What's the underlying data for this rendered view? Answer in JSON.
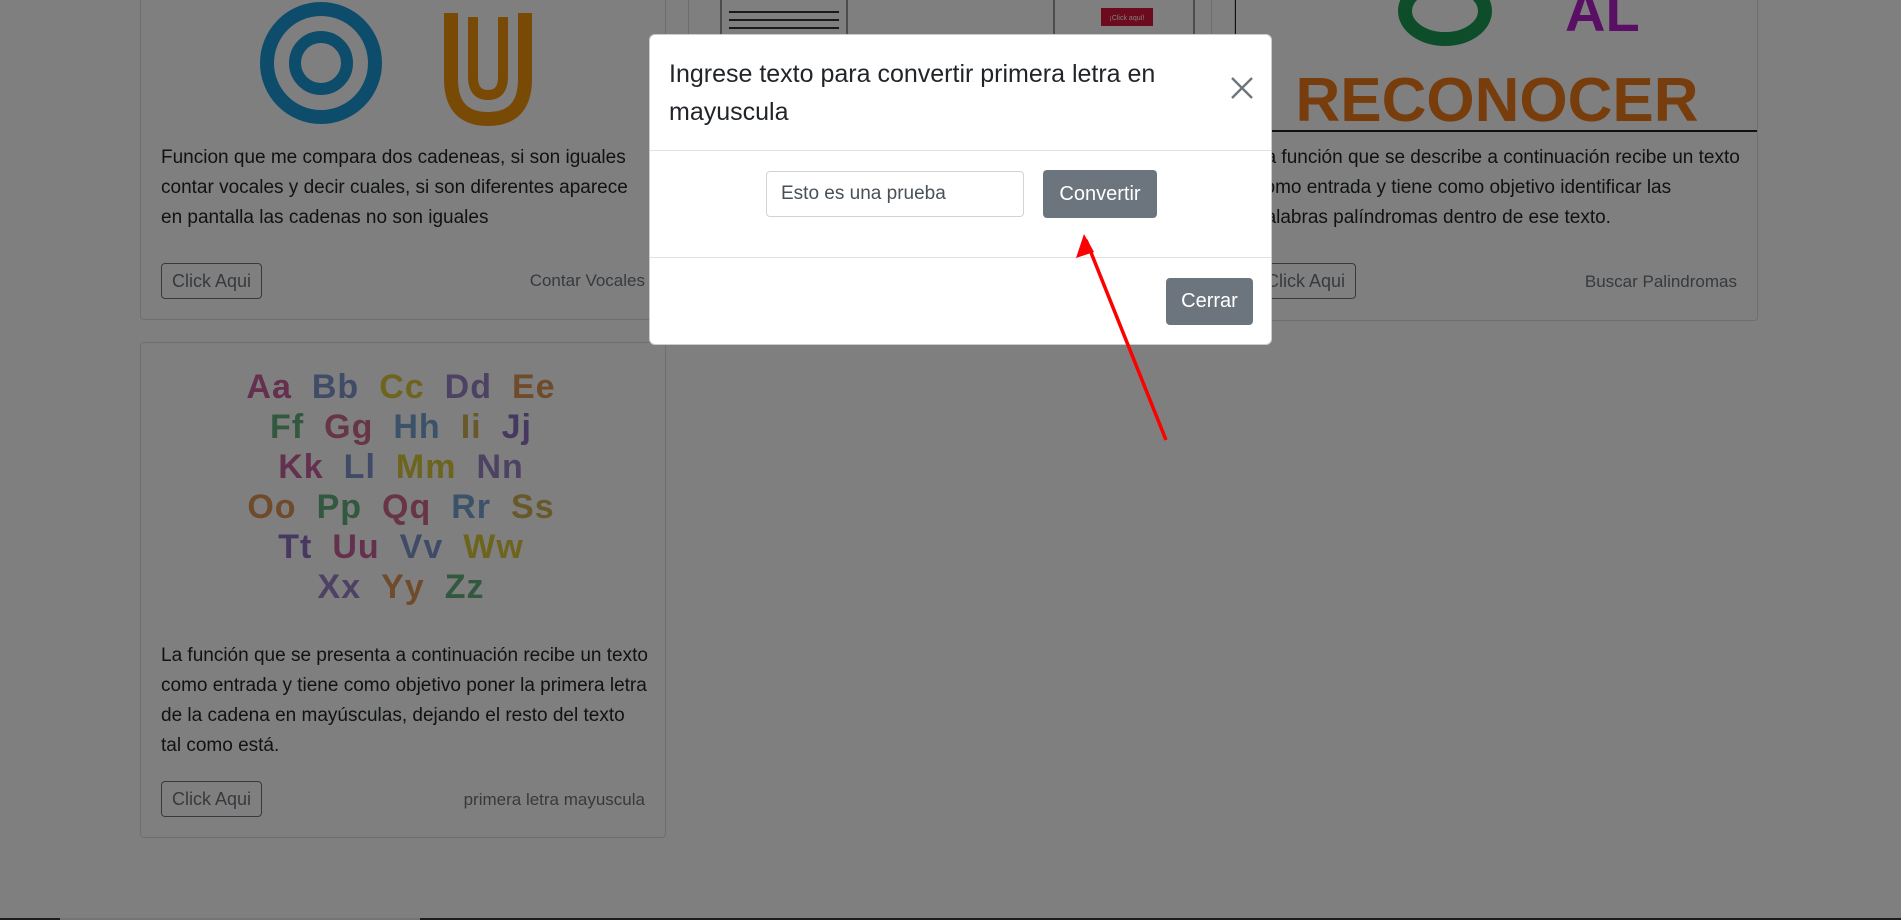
{
  "cards": [
    {
      "description": "Funcion que me compara dos cadeneas, si son iguales contar vocales y decir cuales, si son diferentes aparece en pantalla las cadenas no son iguales",
      "button": "Click Aqui",
      "footer": "Contar Vocales"
    },
    {
      "description": "La función que se describe a continuación recibe un texto como entrada y tiene como objetivo identificar las palabras palíndromas dentro de ese texto.",
      "button": "Click Aqui",
      "footer": "Buscar Palindromas",
      "image_text": "RECONOCER"
    },
    {
      "description": "La función que se presenta a continuación recibe un texto como entrada y tiene como objetivo poner la primera letra de la cadena en mayúsculas, dejando el resto del texto tal como está.",
      "button": "Click Aqui",
      "footer": "primera letra mayuscula",
      "alphabet": [
        "Aa",
        "Bb",
        "Cc",
        "Dd",
        "Ee",
        "Ff",
        "Gg",
        "Hh",
        "Ii",
        "Jj",
        "Kk",
        "Ll",
        "Mm",
        "Nn",
        "Oo",
        "Pp",
        "Qq",
        "Rr",
        "Ss",
        "Tt",
        "Uu",
        "Vv",
        "Ww",
        "Xx",
        "Yy",
        "Zz"
      ]
    }
  ],
  "middle_card": {
    "image_badge": "¡Click aquí!"
  },
  "modal": {
    "title": "Ingrese texto para convertir primera letra en mayuscula",
    "input_value": "Esto es una prueba",
    "convert_button": "Convertir",
    "close_button": "Cerrar",
    "close_icon": "close-icon"
  },
  "colors": {
    "secondary": "#6c757d",
    "arrow": "#ff0000",
    "vowel_o": "#1a9ad6",
    "vowel_u": "#f0940a",
    "reconocer": "#f07b1a"
  }
}
